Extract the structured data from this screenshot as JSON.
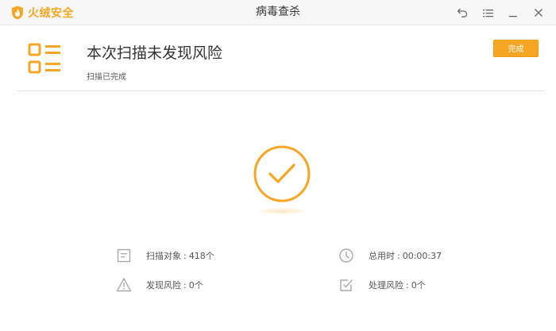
{
  "app": {
    "brand_name": "火绒安全",
    "window_title": "病毒查杀"
  },
  "header": {
    "title": "本次扫描未发现风险",
    "subtitle": "扫描已完成",
    "done_button": "完成"
  },
  "stats": {
    "scan_objects": {
      "label": "扫描对象",
      "value": "418个"
    },
    "total_time": {
      "label": "总用时",
      "value": "00:00:37"
    },
    "risks_found": {
      "label": "发现风险",
      "value": "0个"
    },
    "risks_handled": {
      "label": "处理风险",
      "value": "0个"
    }
  },
  "colors": {
    "accent": "#f6a623",
    "icon_gray": "#a8a8a8"
  },
  "icons": {
    "brand": "flame-shield-icon",
    "back": "back-arrow-icon",
    "menu": "menu-icon",
    "minimize": "minimize-icon",
    "close": "close-icon",
    "report": "report-list-icon",
    "success": "check-circle-icon",
    "document": "document-icon",
    "clock": "clock-icon",
    "warning": "warning-icon",
    "handled": "checkbox-icon"
  }
}
